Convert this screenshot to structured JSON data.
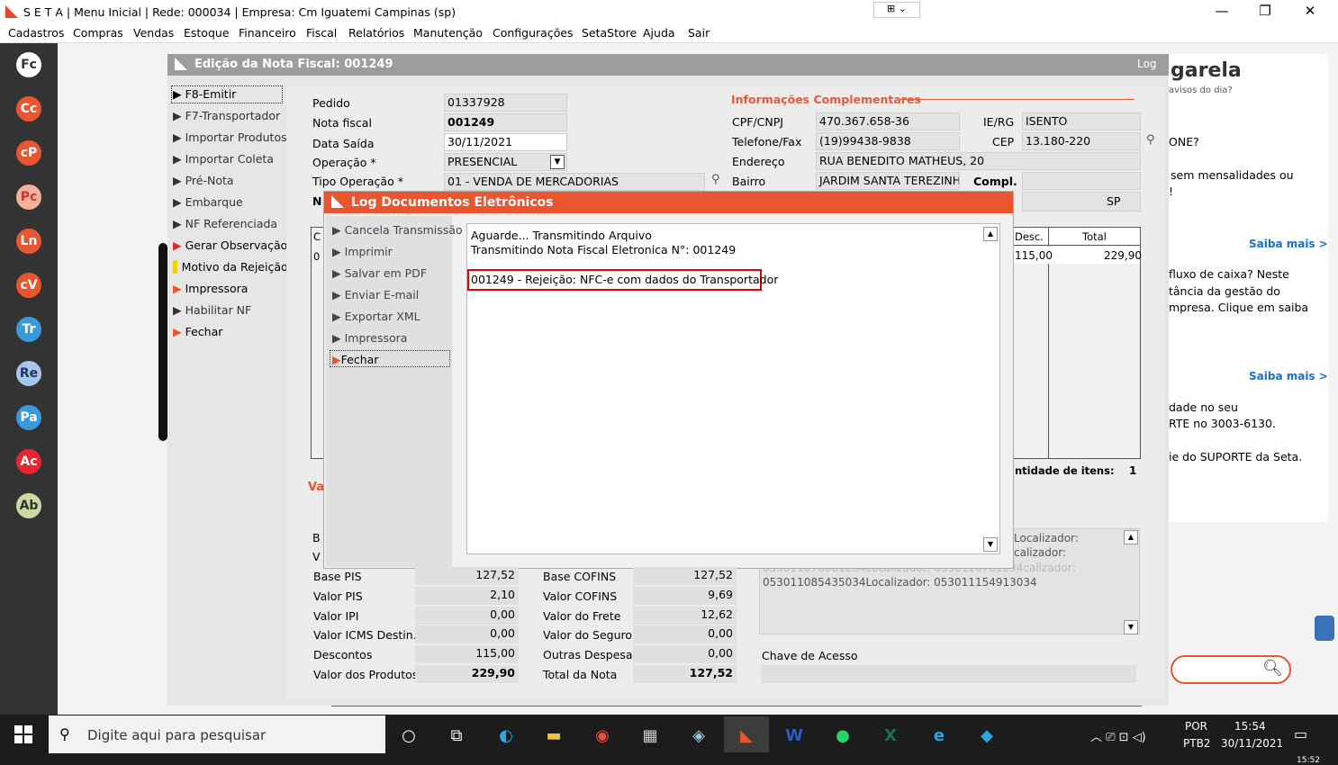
{
  "window": {
    "title": "S E T A | Menu Inicial | Rede: 000034 | Empresa: Cm Iguatemi Campinas (sp)",
    "minimize": "—",
    "restore": "❐",
    "close": "✕"
  },
  "menu": [
    "Cadastros",
    "Compras",
    "Vendas",
    "Estoque",
    "Financeiro",
    "Fiscal",
    "Relatórios",
    "Manutenção",
    "Configurações",
    "SetaStore",
    "Ajuda",
    "Sair"
  ],
  "sidebar": [
    "Fc",
    "Cc",
    "cP",
    "Pc",
    "Ln",
    "cV",
    "Tr",
    "Re",
    "Pa",
    "Ac",
    "Ab"
  ],
  "colors": {
    "accent": "#e8552f",
    "sidebar": "#333333",
    "error_border": "#e00000"
  },
  "editor": {
    "title": "Edição da Nota Fiscal: 001249",
    "log": "Log",
    "nav": [
      "F8-Emitir",
      "F7-Transportador",
      "Importar Produtos",
      "Importar Coleta",
      "Pré-Nota",
      "Embarque",
      "NF Referenciada",
      "Gerar Observação",
      "Motivo da Rejeição",
      "Impressora",
      "Habilitar NF",
      "Fechar"
    ],
    "fields": {
      "pedido_label": "Pedido",
      "pedido": "01337928",
      "nf_label": "Nota fiscal",
      "nf": "001249",
      "data_label": "Data Saída",
      "data": "30/11/2021",
      "op_label": "Operação *",
      "op": "PRESENCIAL",
      "tipo_label": "Tipo Operação *",
      "tipo": "01 - VENDA DE MERCADORIAS",
      "n_label": "N"
    },
    "info": {
      "title": "Informações Complementares",
      "cpf_label": "CPF/CNPJ",
      "cpf": "470.367.658-36",
      "ie_label": "IE/RG",
      "ie": "ISENTO",
      "tel_label": "Telefone/Fax",
      "tel": "(19)99438-9838",
      "cep_label": "CEP",
      "cep": "13.180-220",
      "end_label": "Endereço",
      "end": "RUA BENEDITO MATHEUS, 20",
      "bairro_label": "Bairro",
      "bairro": "JARDIM SANTA TEREZINHA",
      "compl_label": "Compl.",
      "uf": "SP"
    },
    "grid": {
      "c_col": "C",
      "desc_col": "Desc.",
      "total_col": "Total",
      "row_c": "0",
      "row_desc": "115,00",
      "row_total": "229,90",
      "qty_label": "ntidade de itens:",
      "qty": "1"
    },
    "va_label": "Va",
    "b_label": "B",
    "v_label": "V",
    "summary": [
      {
        "l1": "Base PIS",
        "v1": "127,52",
        "l2": "Base COFINS",
        "v2": "127,52"
      },
      {
        "l1": "Valor PIS",
        "v1": "2,10",
        "l2": "Valor COFINS",
        "v2": "9,69"
      },
      {
        "l1": "Valor IPI",
        "v1": "0,00",
        "l2": "Valor do Frete",
        "v2": "12,62"
      },
      {
        "l1": "Valor ICMS Destin.",
        "v1": "0,00",
        "l2": "Valor do Seguro",
        "v2": "0,00"
      },
      {
        "l1": "Descontos",
        "v1": "115,00",
        "l2": "Outras Despesas",
        "v2": "0,00"
      },
      {
        "l1": "Valor dos Produtos",
        "v1": "229,90",
        "l2": "Total da Nota",
        "v2": "127,52"
      }
    ],
    "obs": [
      "Localizador:",
      "calizador:",
      "053011076061234Localizador: 0530110761234calizador:",
      "053011085435034Localizador: 053011154913034"
    ],
    "chave_label": "Chave de Acesso"
  },
  "modal": {
    "title": "Log Documentos Eletrônicos",
    "nav": [
      "Cancela Transmissão",
      "Imprimir",
      "Salvar em PDF",
      "Enviar E-mail",
      "Exportar XML",
      "Impressora",
      "Fechar"
    ],
    "lines": [
      "Aguarde... Transmitindo Arquivo",
      "Transmitindo Nota Fiscal Eletronica N°: 001249"
    ],
    "error": "001249 - Rejeição: NFC-e com dados do Transportador"
  },
  "right": {
    "brand": "garela",
    "sub": "avisos do dia?",
    "q1": "ONE?",
    "t1": "sem mensalidades ou",
    "t1b": "!",
    "saiba": "Saiba mais >",
    "t2a": "fluxo de caixa?  Neste",
    "t2b": "tância da gestão do",
    "t2c": "mpresa. Clique em saiba",
    "t3a": "dade no seu",
    "t3b": "RTE no 3003-6130.",
    "t3c": "ie do SUPORTE da Seta."
  },
  "taskbar": {
    "search": "Digite aqui para pesquisar",
    "lang1": "POR",
    "lang2": "PTB2",
    "time": "15:54",
    "date": "30/11/2021",
    "clock2": "15:52"
  }
}
